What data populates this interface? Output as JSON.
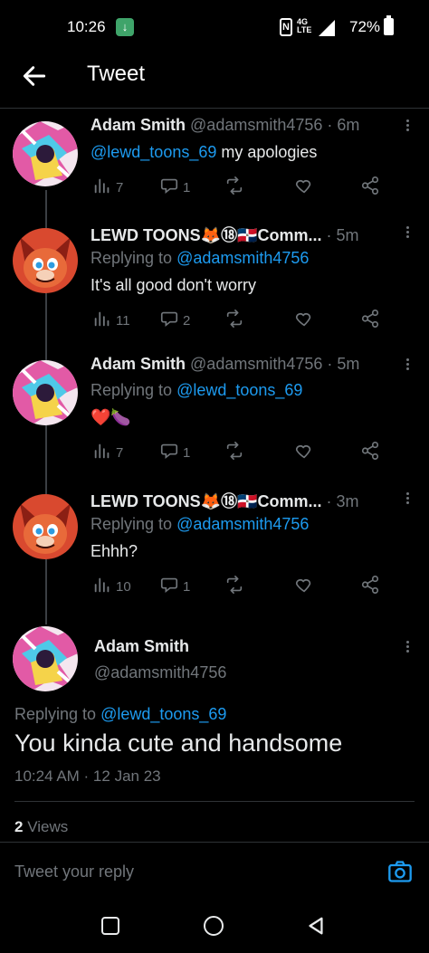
{
  "status_bar": {
    "time": "10:26",
    "network": "4G LTE",
    "battery": "72%"
  },
  "header": {
    "title": "Tweet"
  },
  "thread": [
    {
      "name": "Adam Smith",
      "handle": "@adamsmith4756",
      "age": "· 6m",
      "reply_prefix": "",
      "reply_to": "",
      "mention": "@lewd_toons_69",
      "text": " my apologies",
      "views": "7",
      "replies": "1",
      "retweets": "",
      "likes": "",
      "avatar": "anime-avatar"
    },
    {
      "name": "LEWD TOONS🦊⑱🇩🇴Comm...",
      "handle": "",
      "age": "· 5m",
      "reply_prefix": "Replying to ",
      "reply_to": "@adamsmith4756",
      "mention": "",
      "text": "It's all good don't worry",
      "views": "11",
      "replies": "2",
      "retweets": "",
      "likes": "",
      "avatar": "fox-avatar"
    },
    {
      "name": "Adam Smith",
      "handle": "@adamsmith4756",
      "age": "· 5m",
      "reply_prefix": "Replying to ",
      "reply_to": "@lewd_toons_69",
      "mention": "",
      "text": "❤️🍆",
      "views": "7",
      "replies": "1",
      "retweets": "",
      "likes": "",
      "avatar": "anime-avatar"
    },
    {
      "name": "LEWD TOONS🦊⑱🇩🇴Comm...",
      "handle": "",
      "age": "· 3m",
      "reply_prefix": "Replying to ",
      "reply_to": "@adamsmith4756",
      "mention": "",
      "text": "Ehhh?",
      "views": "10",
      "replies": "1",
      "retweets": "",
      "likes": "",
      "avatar": "fox-avatar"
    }
  ],
  "main_tweet": {
    "name": "Adam Smith",
    "handle": "@adamsmith4756",
    "reply_prefix": "Replying to ",
    "reply_to": "@lewd_toons_69",
    "text": "You kinda cute and handsome",
    "timestamp": "10:24 AM · 12 Jan 23",
    "views_count": "2",
    "views_label": " Views"
  },
  "reply_bar": {
    "placeholder": "Tweet your reply"
  },
  "colors": {
    "background": "#000000",
    "link": "#1d9bf0",
    "muted": "#71767b",
    "text": "#e7e9ea"
  }
}
